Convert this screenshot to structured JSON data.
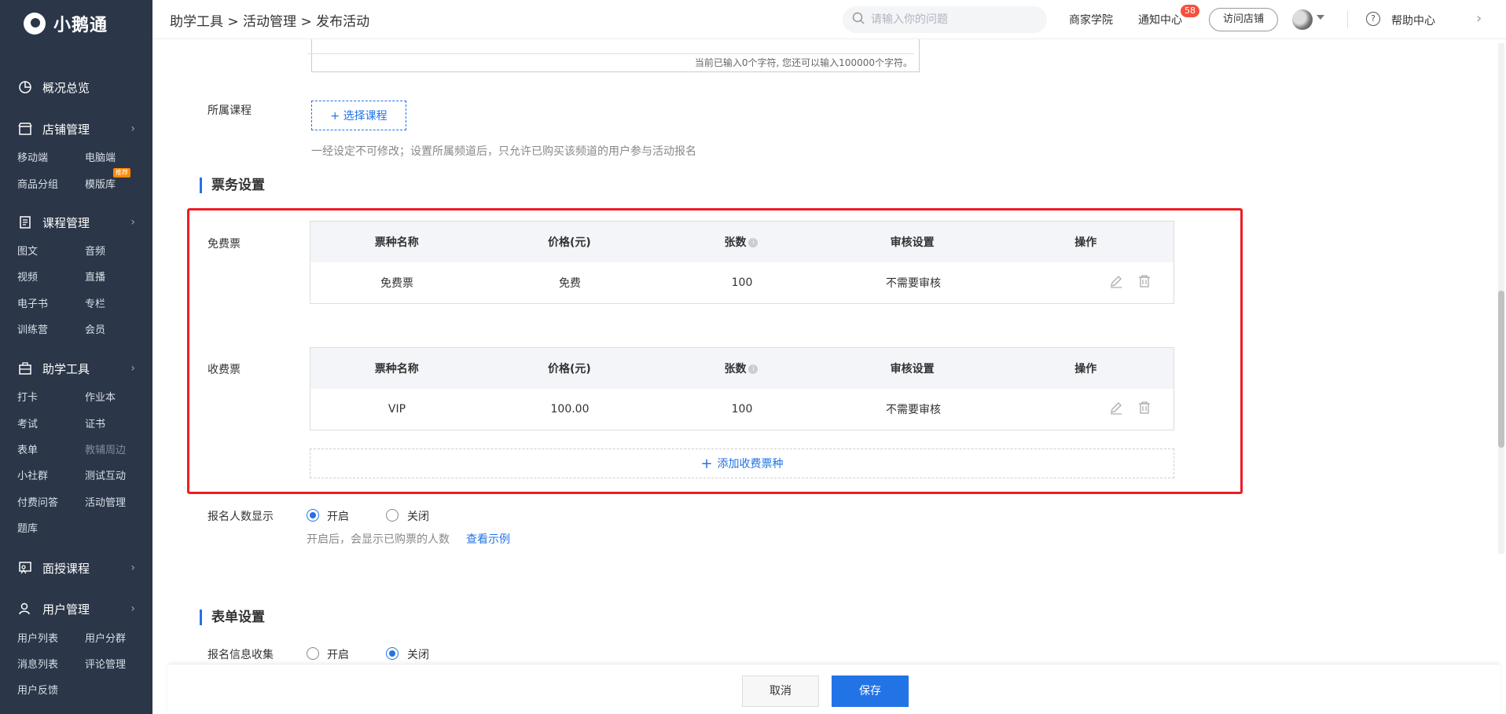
{
  "app": {
    "name": "小鹅通"
  },
  "breadcrumb": "助学工具 > 活动管理 > 发布活动",
  "topbar": {
    "search_placeholder": "请输入你的问题",
    "merchant_academy": "商家学院",
    "notifications": "通知中心",
    "notification_count": "58",
    "visit_store": "访问店铺",
    "help_center": "帮助中心"
  },
  "sidebar": {
    "overview": "概况总览",
    "store": {
      "label": "店铺管理",
      "items": [
        "移动端",
        "电脑端",
        "商品分组",
        "模版库"
      ],
      "badge": "推荐"
    },
    "course": {
      "label": "课程管理",
      "items": [
        "图文",
        "音频",
        "视频",
        "直播",
        "电子书",
        "专栏",
        "训练营",
        "会员"
      ]
    },
    "tools": {
      "label": "助学工具",
      "items": [
        "打卡",
        "作业本",
        "考试",
        "证书",
        "表单",
        "教辅周边",
        "小社群",
        "测试互动",
        "付费问答",
        "活动管理",
        "题库"
      ]
    },
    "offline": {
      "label": "面授课程"
    },
    "users": {
      "label": "用户管理",
      "items": [
        "用户列表",
        "用户分群",
        "消息列表",
        "评论管理",
        "用户反馈"
      ]
    }
  },
  "form": {
    "char_counter": "当前已输入0个字符, 您还可以输入100000个字符。",
    "course_label": "所属课程",
    "select_course": "+ 选择课程",
    "course_hint": "一经设定不可修改；设置所属频道后，只允许已购买该频道的用户参与活动报名",
    "ticket_section": "票务设置",
    "free_label": "免费票",
    "paid_label": "收费票",
    "columns": [
      "票种名称",
      "价格(元)",
      "张数",
      "审核设置",
      "操作"
    ],
    "free_ticket": {
      "name": "免费票",
      "price": "免费",
      "count": "100",
      "review": "不需要审核"
    },
    "paid_ticket": {
      "name": "VIP",
      "price": "100.00",
      "count": "100",
      "review": "不需要审核"
    },
    "add_paid": "添加收费票种",
    "show_count_label": "报名人数显示",
    "on": "开启",
    "off": "关闭",
    "show_count_hint": "开启后，会显示已购票的人数",
    "view_example": "查看示例",
    "form_section": "表单设置",
    "collect_label": "报名信息收集"
  },
  "footer": {
    "cancel": "取消",
    "save": "保存"
  }
}
